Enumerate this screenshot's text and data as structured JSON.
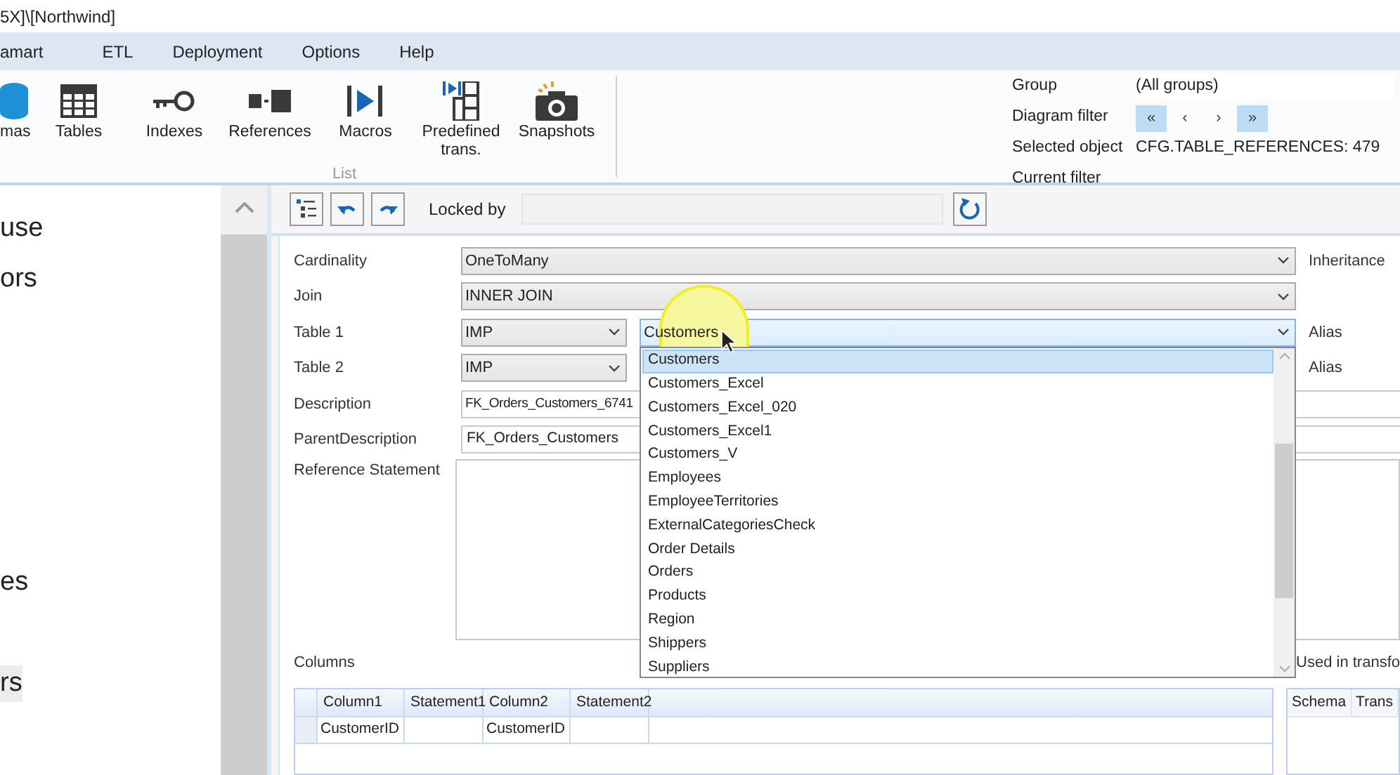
{
  "window": {
    "title": "5X]\\[Northwind]"
  },
  "menu": [
    {
      "label": "amart"
    },
    {
      "label": "ETL"
    },
    {
      "label": "Deployment"
    },
    {
      "label": "Options"
    },
    {
      "label": "Help"
    }
  ],
  "ribbon": {
    "buttons": [
      {
        "label": "mas"
      },
      {
        "label": "Tables"
      },
      {
        "label": "Indexes"
      },
      {
        "label": "References"
      },
      {
        "label": "Macros"
      },
      {
        "label": "Predefined trans."
      },
      {
        "label": "Snapshots"
      }
    ],
    "group_label": "List"
  },
  "info_panel": {
    "group": {
      "label": "Group",
      "value": "(All groups)"
    },
    "diagram_filter": {
      "label": "Diagram filter",
      "buttons": [
        {
          "label": "«",
          "enabled": true
        },
        {
          "label": "‹",
          "enabled": false
        },
        {
          "label": "›",
          "enabled": false
        },
        {
          "label": "»",
          "enabled": true
        }
      ]
    },
    "selected_object": {
      "label": "Selected object",
      "value": "CFG.TABLE_REFERENCES: 479"
    },
    "current_filter": {
      "label": "Current filter"
    }
  },
  "sidebar": {
    "items": [
      {
        "label": "use",
        "selected": false
      },
      {
        "label": "ors",
        "selected": false
      },
      {
        "label": "es",
        "selected": false
      },
      {
        "label": "rs",
        "selected": true
      }
    ]
  },
  "editor": {
    "locked_by": {
      "label": "Locked by"
    },
    "cardinality": {
      "label": "Cardinality",
      "value": "OneToMany"
    },
    "join": {
      "label": "Join",
      "value": "INNER JOIN"
    },
    "table1": {
      "label": "Table 1",
      "schema": "IMP",
      "table": "Customers"
    },
    "table2": {
      "label": "Table 2",
      "schema": "IMP"
    },
    "description": {
      "label": "Description",
      "value": "FK_Orders_Customers_6741"
    },
    "parent_description": {
      "label": "ParentDescription",
      "value": "FK_Orders_Customers"
    },
    "reference_statement": {
      "label": "Reference Statement"
    },
    "side_labels": [
      "Inheritance",
      "Alias",
      "Alias"
    ],
    "columns_label": "Columns",
    "used_in_label": "Used in transfo",
    "grid": {
      "columns": [
        "Column1",
        "Statement1",
        "Column2",
        "Statement2"
      ],
      "rows": [
        {
          "column1": "CustomerID",
          "column2": "CustomerID"
        }
      ]
    },
    "used_in_grid": {
      "columns": [
        "Schema",
        "Trans"
      ]
    }
  },
  "dropdown": {
    "items": [
      {
        "label": "Customers",
        "selected": true
      },
      {
        "label": "Customers_Excel",
        "selected": false
      },
      {
        "label": "Customers_Excel_020",
        "selected": false
      },
      {
        "label": "Customers_Excel1",
        "selected": false
      },
      {
        "label": "Customers_V",
        "selected": false
      },
      {
        "label": "Employees",
        "selected": false
      },
      {
        "label": "EmployeeTerritories",
        "selected": false
      },
      {
        "label": "ExternalCategoriesCheck",
        "selected": false
      },
      {
        "label": "Order Details",
        "selected": false
      },
      {
        "label": "Orders",
        "selected": false
      },
      {
        "label": "Products",
        "selected": false
      },
      {
        "label": "Region",
        "selected": false
      },
      {
        "label": "Shippers",
        "selected": false
      },
      {
        "label": "Suppliers",
        "selected": false
      }
    ]
  }
}
